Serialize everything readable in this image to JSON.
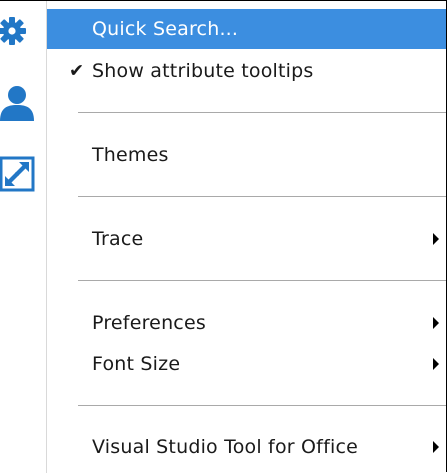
{
  "sidebar": {
    "buttons": [
      {
        "icon": "gear-icon",
        "color": "#2277c6"
      },
      {
        "icon": "user-icon",
        "color": "#2277c6"
      },
      {
        "icon": "expand-icon",
        "color": "#2277c6"
      }
    ]
  },
  "menu": {
    "highlight_color": "#3c8ee0",
    "items": {
      "quick_search": {
        "label": "Quick Search..."
      },
      "attribute_tooltips": {
        "label": "Show attribute tooltips",
        "check": "✔",
        "checked": true
      },
      "themes": {
        "label": "Themes"
      },
      "trace": {
        "label": "Trace"
      },
      "preferences": {
        "label": "Preferences"
      },
      "font_size": {
        "label": "Font Size"
      },
      "vsto": {
        "label": "Visual Studio Tool for Office"
      }
    }
  }
}
